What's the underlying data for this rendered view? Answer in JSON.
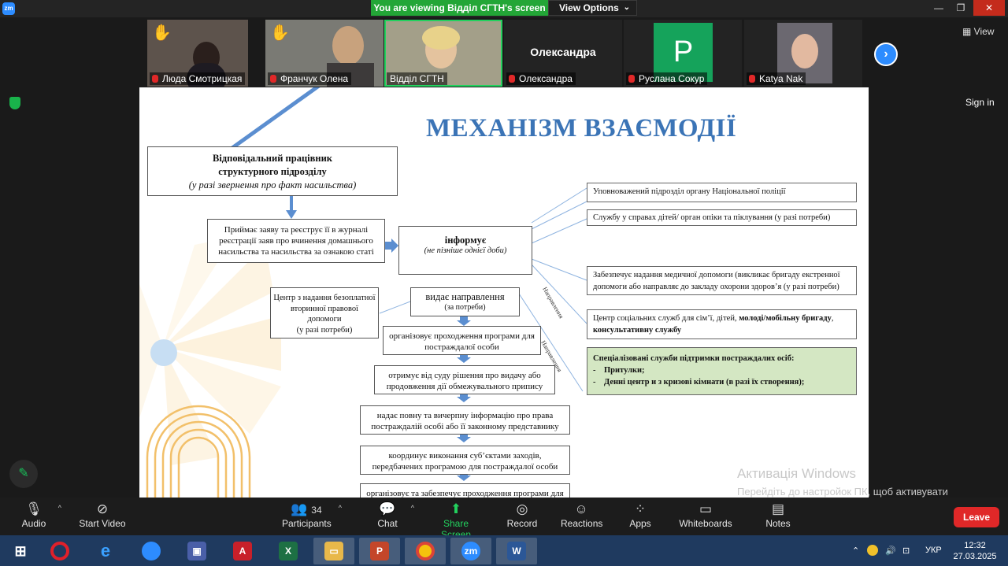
{
  "window": {
    "app_logo": "zm",
    "banner_text": "You are viewing Відділ СГТН's screen",
    "view_options_label": "View Options",
    "buttons": [
      "minimize-icon",
      "restore-icon",
      "close-icon"
    ]
  },
  "participants": [
    {
      "name": "Люда Смотрицкая",
      "muted": true,
      "hand_raised": true
    },
    {
      "name": "Франчук Олена",
      "muted": true,
      "hand_raised": true
    },
    {
      "name": "Відділ СГТН",
      "muted": false,
      "active_speaker": true
    },
    {
      "name": "Олександра",
      "muted": true,
      "display_name_big": "Олександра"
    },
    {
      "name": "Руслана Сокур",
      "muted": true,
      "avatar_letter": "P"
    },
    {
      "name": "Katya Nak",
      "muted": true
    }
  ],
  "top_right": {
    "view_label": "View",
    "sign_in": "Sign in"
  },
  "slide": {
    "title": "МЕХАНІЗМ ВЗАЄМОДІЇ",
    "responsible": {
      "line1": "Відповідальний працівник",
      "line2": "структурного підрозділу",
      "line3": "(у разі звернення про факт насильства)"
    },
    "accepts": "Приймає заяву та реєструє її в журналі реєстрації заяв про вчинення домашнього насильства та насильства за ознакою статі",
    "informs": {
      "title": "інформує",
      "subtitle": "(не пізніше однієї доби)"
    },
    "center_legal": {
      "text": "Центр з надання безоплатної вторинної правової допомоги",
      "note": "(у разі потреби)"
    },
    "issues_referral": {
      "title": "видає направлення",
      "note": "(за потреби)"
    },
    "flow": [
      "організовує проходження програми для постраждалої особи",
      "отримує від суду рішення про видачу або продовження дії обмежувального припису",
      "надає повну та вичерпну інформацію про права постраждалій особі або її законному представнику",
      "координує виконання суб’єктами заходів, передбачених програмою для постраждалої особи",
      "організовує та забезпечує проходження  програми для кривдника"
    ],
    "right_boxes": [
      "Уповноважений підрозділ органу Національної поліції",
      "Службу у справах дітей/ орган опіки та піклування (у разі потреби)",
      "Забезпечує надання медичної допомоги (викликає бригаду екстренної допомоги або направляє до закладу охорони здоров’я (у разі потреби)"
    ],
    "social_center": {
      "prefix": "Центр соціальних служб для сім’ї, дітей,",
      "bold1": "молоді/мобільну бригаду",
      "bold2": "консультативну службу"
    },
    "specialized": {
      "title": "Спеціалізовані служби підтримки постраждалих осіб:",
      "items": [
        "Притулки;",
        "Денні центр и з кризові кімнати (в разі їх створення);"
      ]
    },
    "arrow_label": "Направлення"
  },
  "watermark": {
    "line1": "Активація Windows",
    "line2": "Перейдіть до настройок ПК, щоб активувати Windows."
  },
  "controls": {
    "audio": "Audio",
    "start_video": "Start Video",
    "participants": "Participants",
    "participants_count": "34",
    "chat": "Chat",
    "share_screen": "Share Screen",
    "record": "Record",
    "reactions": "Reactions",
    "apps": "Apps",
    "whiteboards": "Whiteboards",
    "notes": "Notes",
    "leave": "Leave"
  },
  "taskbar": {
    "apps": [
      "windows-start-icon",
      "opera-icon",
      "ie-icon",
      "bird-icon",
      "save-icon",
      "acrobat-icon",
      "excel-icon",
      "file-explorer-icon",
      "powerpoint-icon",
      "chrome-icon",
      "zoom-icon",
      "word-icon"
    ],
    "language": "УКР",
    "time": "12:32",
    "date": "27.03.2025"
  }
}
